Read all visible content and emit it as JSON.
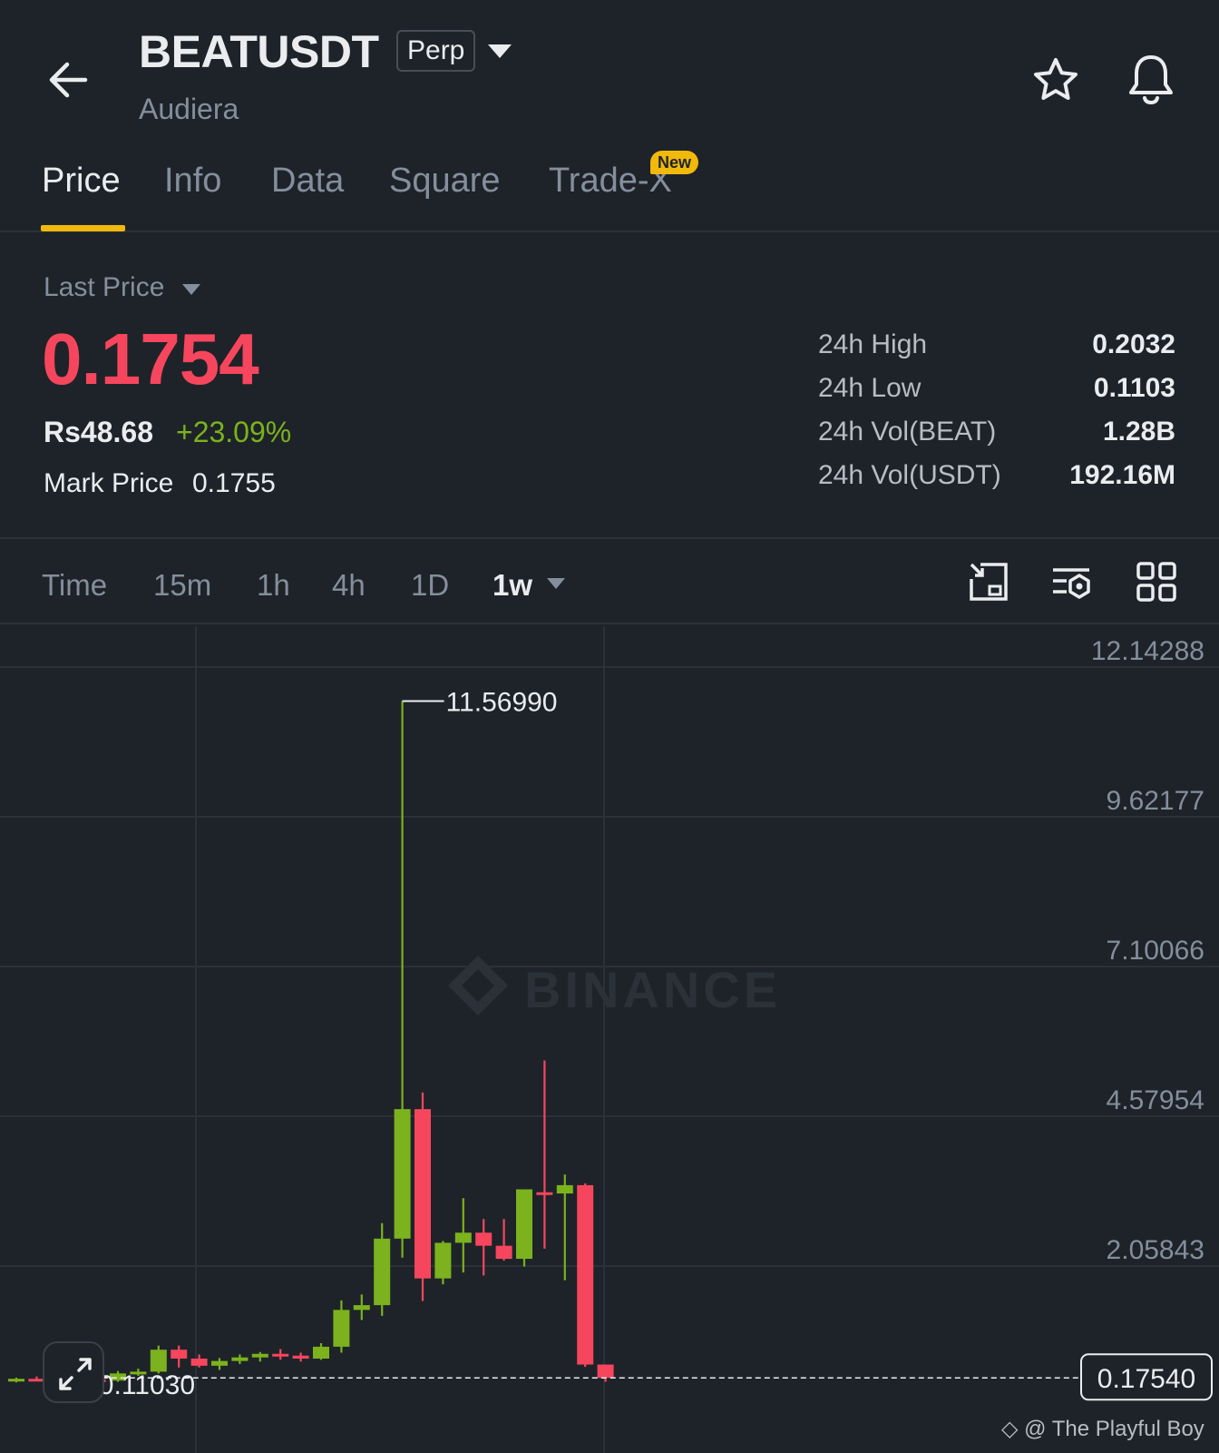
{
  "header": {
    "symbol": "BEATUSDT",
    "contract_type": "Perp",
    "name": "Audiera"
  },
  "tabs": [
    {
      "label": "Price",
      "active": true
    },
    {
      "label": "Info"
    },
    {
      "label": "Data"
    },
    {
      "label": "Square"
    },
    {
      "label": "Trade-X",
      "badge": "New"
    }
  ],
  "price": {
    "label": "Last Price",
    "value": "0.1754",
    "fiat": "Rs48.68",
    "change": "+23.09%",
    "mark_label": "Mark Price",
    "mark_value": "0.1755"
  },
  "stats": [
    {
      "label": "24h High",
      "value": "0.2032"
    },
    {
      "label": "24h Low",
      "value": "0.1103"
    },
    {
      "label": "24h Vol(BEAT)",
      "value": "1.28B"
    },
    {
      "label": "24h Vol(USDT)",
      "value": "192.16M"
    }
  ],
  "intervals": {
    "items": [
      "Time",
      "15m",
      "1h",
      "4h",
      "1D"
    ],
    "active": "1w"
  },
  "colors": {
    "up": "#7bb21d",
    "down": "#f6465d",
    "accent": "#f0b90b",
    "background": "#1e2329"
  },
  "icons": {
    "back": "arrow-left-icon",
    "favorite": "star-icon",
    "alert": "bell-icon",
    "tools": [
      "chart-settings-icon",
      "indicator-settings-icon",
      "grid-layout-icon"
    ],
    "expand": "expand-icon"
  },
  "chart_data": {
    "type": "candlestick",
    "interval": "1w",
    "y_ticks": [
      "12.14288",
      "9.62177",
      "7.10066",
      "4.57954",
      "2.05843"
    ],
    "ylim": [
      -0.3,
      12.3
    ],
    "high_label": "11.56990",
    "low_label": "0.11030",
    "current_price_label": "0.17540",
    "watermark": "BINANCE",
    "candles": [
      {
        "o": 0.14,
        "h": 0.18,
        "l": 0.1,
        "c": 0.16
      },
      {
        "o": 0.16,
        "h": 0.2,
        "l": 0.12,
        "c": 0.13
      },
      {
        "o": 0.13,
        "h": 0.17,
        "l": 0.09,
        "c": 0.11
      },
      {
        "o": 0.11,
        "h": 0.18,
        "l": 0.09,
        "c": 0.15
      },
      {
        "o": 0.15,
        "h": 0.2,
        "l": 0.12,
        "c": 0.13
      },
      {
        "o": 0.13,
        "h": 0.29,
        "l": 0.11,
        "c": 0.25
      },
      {
        "o": 0.25,
        "h": 0.33,
        "l": 0.21,
        "c": 0.28
      },
      {
        "o": 0.28,
        "h": 0.72,
        "l": 0.25,
        "c": 0.65
      },
      {
        "o": 0.65,
        "h": 0.72,
        "l": 0.35,
        "c": 0.5
      },
      {
        "o": 0.5,
        "h": 0.57,
        "l": 0.35,
        "c": 0.38
      },
      {
        "o": 0.38,
        "h": 0.51,
        "l": 0.31,
        "c": 0.46
      },
      {
        "o": 0.46,
        "h": 0.57,
        "l": 0.41,
        "c": 0.52
      },
      {
        "o": 0.52,
        "h": 0.61,
        "l": 0.45,
        "c": 0.58
      },
      {
        "o": 0.58,
        "h": 0.66,
        "l": 0.48,
        "c": 0.55
      },
      {
        "o": 0.55,
        "h": 0.6,
        "l": 0.45,
        "c": 0.5
      },
      {
        "o": 0.5,
        "h": 0.76,
        "l": 0.48,
        "c": 0.7
      },
      {
        "o": 0.7,
        "h": 1.48,
        "l": 0.6,
        "c": 1.32
      },
      {
        "o": 1.32,
        "h": 1.58,
        "l": 1.15,
        "c": 1.4
      },
      {
        "o": 1.4,
        "h": 2.78,
        "l": 1.22,
        "c": 2.52
      },
      {
        "o": 2.52,
        "h": 11.5699,
        "l": 2.2,
        "c": 4.7
      },
      {
        "o": 4.7,
        "h": 4.98,
        "l": 1.47,
        "c": 1.85
      },
      {
        "o": 1.85,
        "h": 2.48,
        "l": 1.75,
        "c": 2.45
      },
      {
        "o": 2.45,
        "h": 3.2,
        "l": 1.95,
        "c": 2.62
      },
      {
        "o": 2.62,
        "h": 2.85,
        "l": 1.9,
        "c": 2.4
      },
      {
        "o": 2.4,
        "h": 2.85,
        "l": 2.15,
        "c": 2.18
      },
      {
        "o": 2.18,
        "h": 3.2,
        "l": 2.05,
        "c": 3.35
      },
      {
        "o": 3.3,
        "h": 5.52,
        "l": 2.35,
        "c": 3.28
      },
      {
        "o": 3.28,
        "h": 3.6,
        "l": 1.82,
        "c": 3.42
      },
      {
        "o": 3.42,
        "h": 3.45,
        "l": 0.36,
        "c": 0.4
      },
      {
        "o": 0.4,
        "h": 0.4,
        "l": 0.1103,
        "c": 0.1754
      }
    ]
  }
}
